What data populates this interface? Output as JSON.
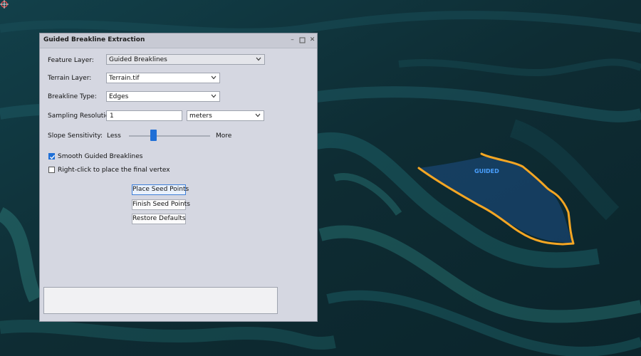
{
  "dialog": {
    "title": "Guided Breakline Extraction",
    "feature_layer": {
      "label": "Feature Layer:",
      "value": "Guided Breaklines"
    },
    "terrain_layer": {
      "label": "Terrain Layer:",
      "value": "Terrain.tif"
    },
    "breakline_type": {
      "label": "Breakline Type:",
      "value": "Edges"
    },
    "sampling_resolution": {
      "label": "Sampling Resolution:",
      "value": "1",
      "unit": "meters"
    },
    "slope_sensitivity": {
      "label": "Slope Sensitivity:",
      "min_label": "Less",
      "max_label": "More",
      "level": 0.3
    },
    "smooth_breaklines": {
      "label": "Smooth Guided Breaklines",
      "checked": true
    },
    "right_click_final": {
      "label": "Right-click to place the final vertex",
      "checked": false
    },
    "buttons": {
      "place_seed": "Place Seed Points",
      "finish_seed": "Finish Seed Points",
      "restore_defaults": "Restore Defaults"
    }
  },
  "map": {
    "feature_label": "GUIDED",
    "colors": {
      "breakline": "#f5a623",
      "polygon_fill": "#1d4f86",
      "label": "#4aa0ff"
    }
  }
}
